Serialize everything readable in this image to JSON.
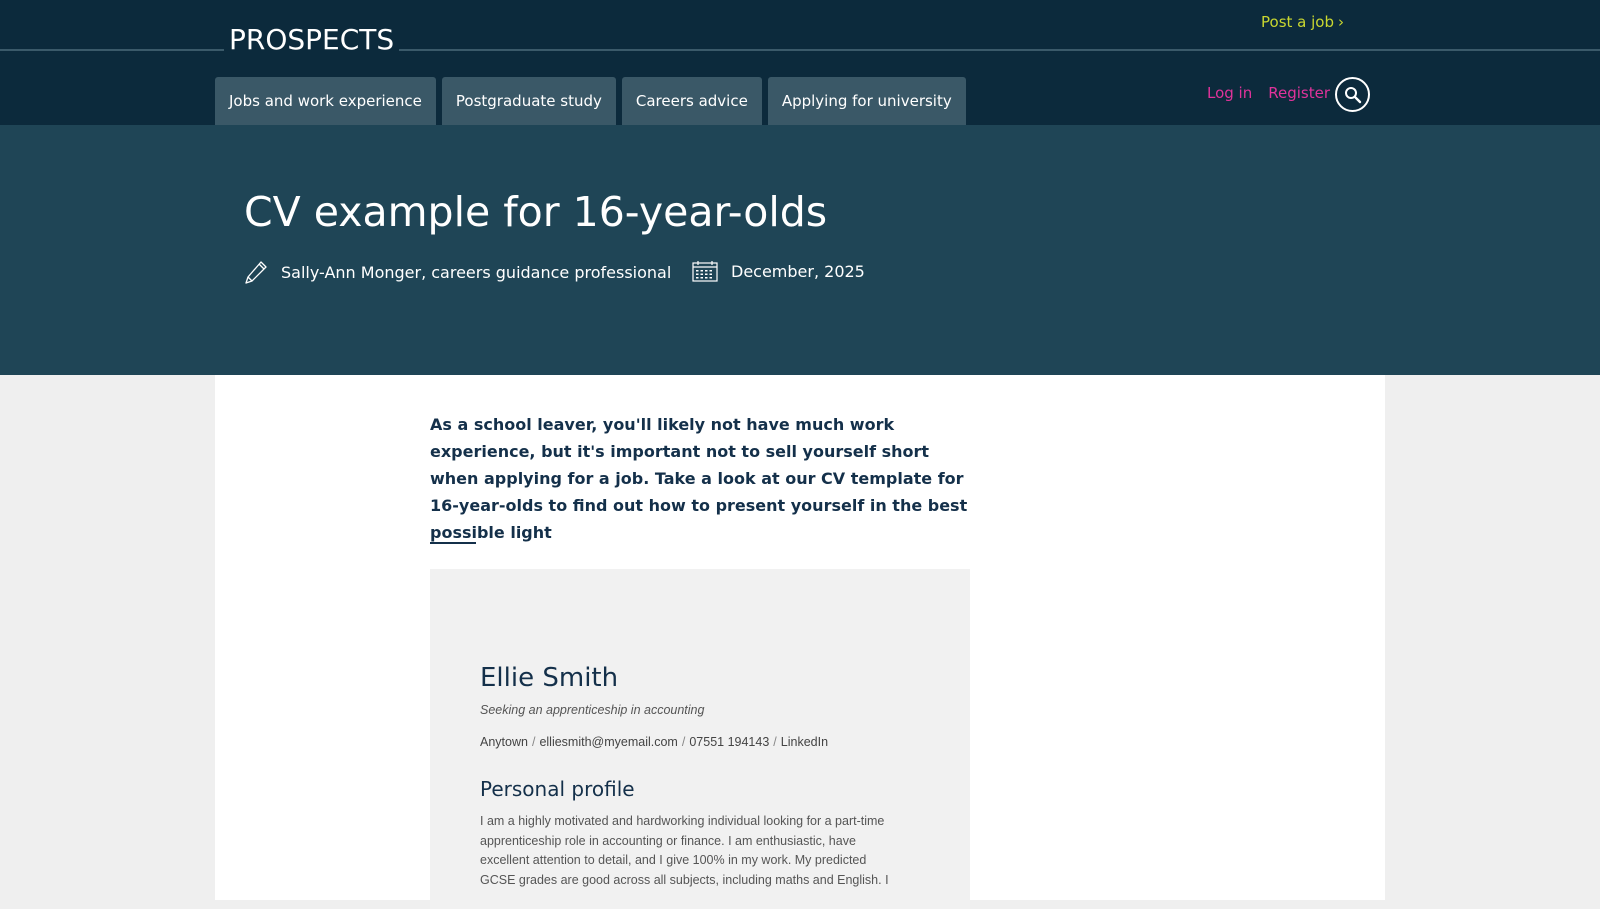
{
  "site": {
    "logo": "PROSPECTS",
    "post_job": "Post a job",
    "post_job_chevron": "›"
  },
  "nav": {
    "tabs": [
      {
        "label": "Jobs and work experience"
      },
      {
        "label": "Postgraduate study"
      },
      {
        "label": "Careers advice"
      },
      {
        "label": "Applying for university"
      }
    ],
    "login": "Log in",
    "register": "Register",
    "search_icon": "search-icon"
  },
  "hero": {
    "title": "CV example for 16-year-olds",
    "author": "Sally-Ann Monger, careers guidance professional",
    "date": "December, 2025",
    "author_icon": "pencil-icon",
    "date_icon": "calendar-icon"
  },
  "article": {
    "lede": "As a school leaver, you'll likely not have much work experience, but it's important not to sell yourself short when applying for a job. Take a look at our CV template for 16-year-olds to find out how to present yourself in the best possible light"
  },
  "cv": {
    "name": "Ellie Smith",
    "tagline": "Seeking an apprenticeship in accounting",
    "contact": {
      "town": "Anytown",
      "email": "elliesmith@myemail.com",
      "phone": "07551 194143",
      "linkedin": "LinkedIn",
      "separator": "/"
    },
    "section_title": "Personal profile",
    "profile": "I am a highly motivated and hardworking individual looking for a part-time apprenticeship role in accounting or finance. I am enthusiastic, have excellent attention to detail, and I give 100% in my work. My predicted GCSE grades are good across all subjects, including maths and English. I"
  },
  "colors": {
    "header_bg": "#0c2a3c",
    "hero_bg": "#1f4556",
    "tab_bg": "#3a5867",
    "post_job": "#c9d730",
    "account_link": "#e0339b",
    "heading_text": "#14304a"
  }
}
